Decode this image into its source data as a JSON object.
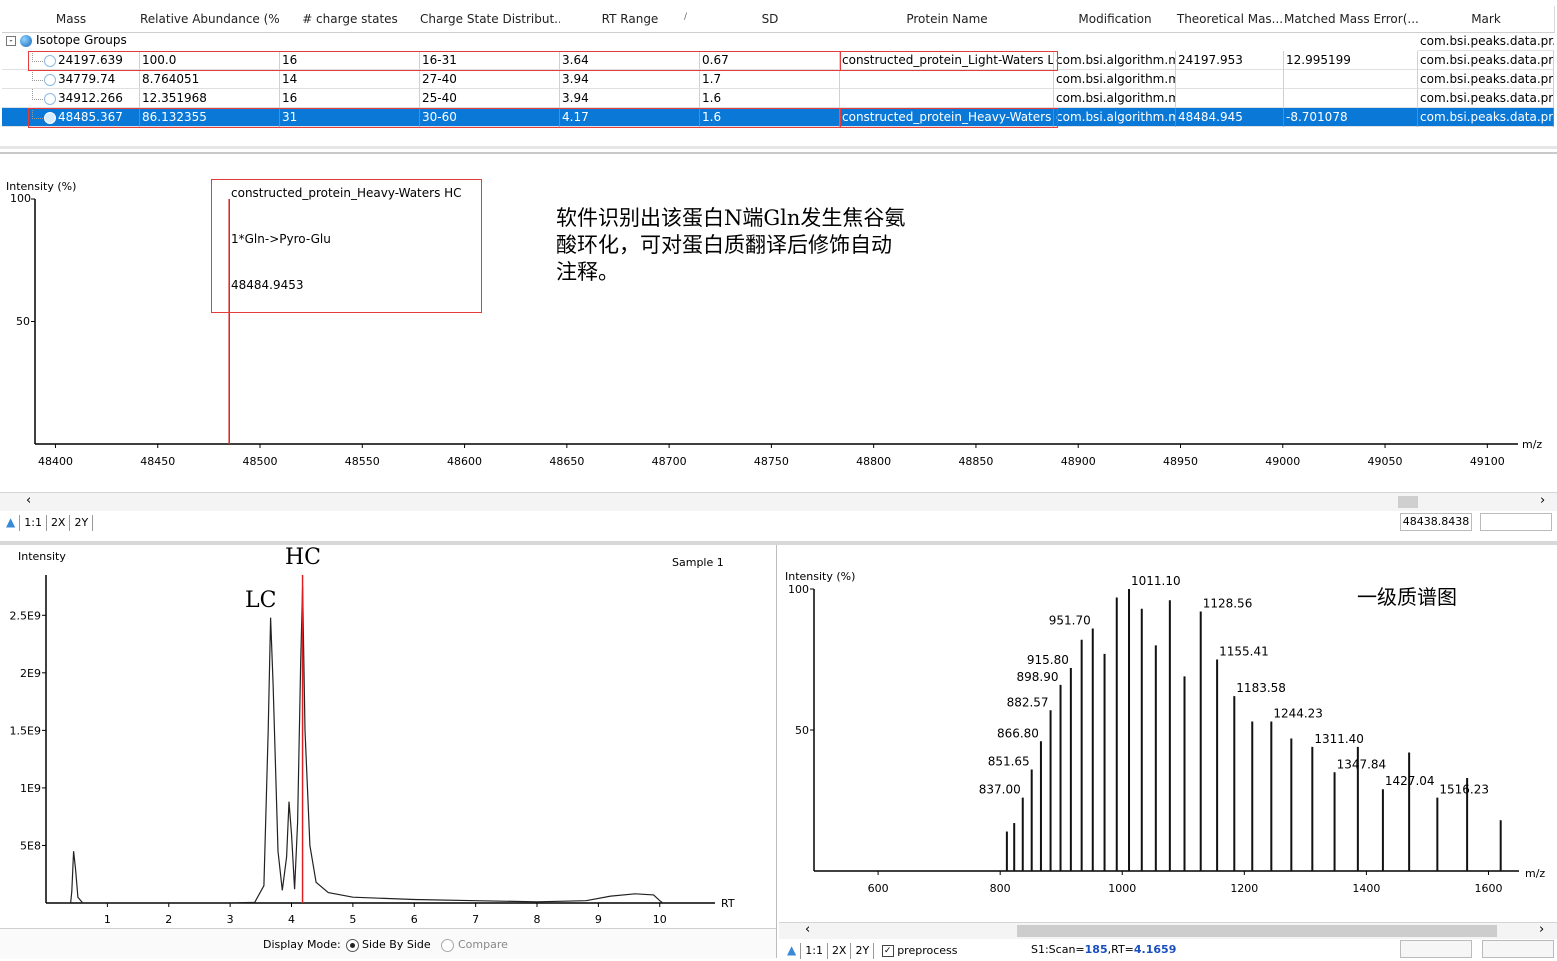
{
  "table": {
    "headers": [
      "Mass",
      "Relative Abundance (%)",
      "# charge states",
      "Charge State Distribut...",
      "RT Range",
      "SD",
      "Protein Name",
      "Modification",
      "Theoretical Mas...",
      "Matched Mass Error(...",
      "Mark"
    ],
    "sort_indicator": "/",
    "group_label": "Isotope Groups",
    "group_mark": "com.bsi.peaks.data.pr...",
    "rows": [
      [
        "24197.639",
        "100.0",
        "16",
        "16-31",
        "3.64",
        "0.67",
        "constructed_protein_Light-Waters LC",
        "com.bsi.algorithm.m...",
        "24197.953",
        "12.995199",
        "com.bsi.peaks.data.pr..."
      ],
      [
        "34779.74",
        "8.764051",
        "14",
        "27-40",
        "3.94",
        "1.7",
        "",
        "com.bsi.algorithm.m...",
        "",
        "",
        "com.bsi.peaks.data.pr..."
      ],
      [
        "34912.266",
        "12.351968",
        "16",
        "25-40",
        "3.94",
        "1.6",
        "",
        "com.bsi.algorithm.m...",
        "",
        "",
        "com.bsi.peaks.data.pr..."
      ],
      [
        "48485.367",
        "86.132355",
        "31",
        "30-60",
        "4.17",
        "1.6",
        "constructed_protein_Heavy-Waters HC",
        "com.bsi.algorithm.m...",
        "48484.945",
        "-8.701078",
        "com.bsi.peaks.data.pr..."
      ]
    ]
  },
  "deconv": {
    "ylabel": "Intensity (%)",
    "yticks": [
      "100",
      "50"
    ],
    "xlabel": "m/z",
    "xticks": [
      "48400",
      "48450",
      "48500",
      "48550",
      "48600",
      "48650",
      "48700",
      "48750",
      "48800",
      "48850",
      "48900",
      "48950",
      "49000",
      "49050",
      "49100"
    ],
    "annotation": [
      "constructed_protein_Heavy-Waters HC",
      "1*Gln->Pyro-Glu",
      "48484.9453"
    ],
    "note": [
      "软件识别出该蛋白N端Gln发生焦谷氨",
      "酸环化，可对蛋白质翻译后修饰自动",
      "注释。"
    ],
    "toolbar": [
      "1:1",
      "2X",
      "2Y"
    ],
    "scroll_value": "48438.8438"
  },
  "chrom": {
    "ylabel": "Intensity",
    "sample": "Sample 1",
    "label_lc": "LC",
    "label_hc": "HC",
    "yticks": [
      "2.5E9",
      "2E9",
      "1.5E9",
      "1E9",
      "5E8"
    ],
    "xticks": [
      "1",
      "2",
      "3",
      "4",
      "5",
      "6",
      "7",
      "8",
      "9",
      "10"
    ],
    "xlabel": "RT",
    "display_mode_label": "Display Mode:",
    "opt_side": "Side By Side",
    "opt_compare": "Compare"
  },
  "ms1": {
    "ylabel": "Intensity (%)",
    "yticks": [
      "100",
      "50"
    ],
    "title": "一级质谱图",
    "xticks": [
      "600",
      "800",
      "1000",
      "1200",
      "1400",
      "1600"
    ],
    "xlabel": "m/z",
    "toolbar": [
      "1:1",
      "2X",
      "2Y"
    ],
    "preprocess": "preprocess",
    "scan_prefix": "S1:Scan=",
    "scan_value": "185",
    "rt_prefix": ",RT=",
    "rt_value": "4.1659"
  },
  "chart_data": [
    {
      "type": "bar",
      "title": "",
      "xlabel": "m/z",
      "ylabel": "Intensity (%)",
      "xlim": [
        48390,
        49115
      ],
      "ylim": [
        0,
        100
      ],
      "x": [
        48484.9453
      ],
      "values": [
        100
      ],
      "annotations": [
        "constructed_protein_Heavy-Waters HC",
        "1*Gln->Pyro-Glu",
        "48484.9453"
      ]
    },
    {
      "type": "line",
      "title": "",
      "xlabel": "RT",
      "ylabel": "Intensity",
      "xlim": [
        0,
        10.9
      ],
      "ylim": [
        0,
        2850000000.0
      ],
      "series": [
        {
          "x": [
            0.2,
            0.4,
            0.42,
            0.45,
            0.48,
            0.52,
            0.6,
            1,
            2,
            3,
            3.4,
            3.55,
            3.62,
            3.66,
            3.7,
            3.78,
            3.85,
            3.92,
            3.96,
            4.0,
            4.05,
            4.1,
            4.15,
            4.18,
            4.22,
            4.3,
            4.4,
            4.6,
            5,
            6,
            7,
            8,
            8.8,
            9.2,
            9.6,
            9.9,
            10,
            10.05
          ],
          "values": [
            0,
            0,
            100000000.0,
            450000000.0,
            300000000.0,
            50000000.0,
            0,
            0,
            0,
            0,
            5000000.0,
            150000000.0,
            1500000000.0,
            2480000000.0,
            1900000000.0,
            450000000.0,
            110000000.0,
            400000000.0,
            880000000.0,
            600000000.0,
            120000000.0,
            700000000.0,
            2100000000.0,
            2750000000.0,
            1500000000.0,
            500000000.0,
            180000000.0,
            90000000.0,
            50000000.0,
            30000000.0,
            20000000.0,
            10000000.0,
            20000000.0,
            60000000.0,
            80000000.0,
            70000000.0,
            20000000.0,
            0
          ]
        }
      ]
    },
    {
      "type": "bar",
      "title": "",
      "xlabel": "m/z",
      "ylabel": "Intensity (%)",
      "xlim": [
        495,
        1650
      ],
      "ylim": [
        0,
        100
      ],
      "x": [
        811,
        823,
        837,
        851.65,
        866.8,
        882.57,
        898.9,
        915.8,
        933.5,
        951.7,
        971,
        991,
        1011.1,
        1032,
        1055,
        1078,
        1102,
        1128.56,
        1155.41,
        1183.58,
        1213,
        1244.23,
        1277,
        1311.4,
        1347.84,
        1386,
        1427.04,
        1470,
        1516.23,
        1565,
        1620
      ],
      "values": [
        14,
        17,
        26,
        36,
        46,
        57,
        66,
        72,
        82,
        86,
        77,
        97,
        100,
        93,
        80,
        96,
        69,
        92,
        75,
        62,
        53,
        53,
        47,
        44,
        35,
        44,
        29,
        42,
        26,
        33,
        18
      ],
      "labels": {
        "837.00": 837.0,
        "851.65": 851.65,
        "866.80": 866.8,
        "882.57": 882.57,
        "898.90": 898.9,
        "915.80": 915.8,
        "951.70": 951.7,
        "1011.10": 1011.1,
        "1128.56": 1128.56,
        "1155.41": 1155.41,
        "1183.58": 1183.58,
        "1244.23": 1244.23,
        "1311.40": 1311.4,
        "1347.84": 1347.84,
        "1427.04": 1427.04,
        "1516.23": 1516.23
      }
    }
  ]
}
